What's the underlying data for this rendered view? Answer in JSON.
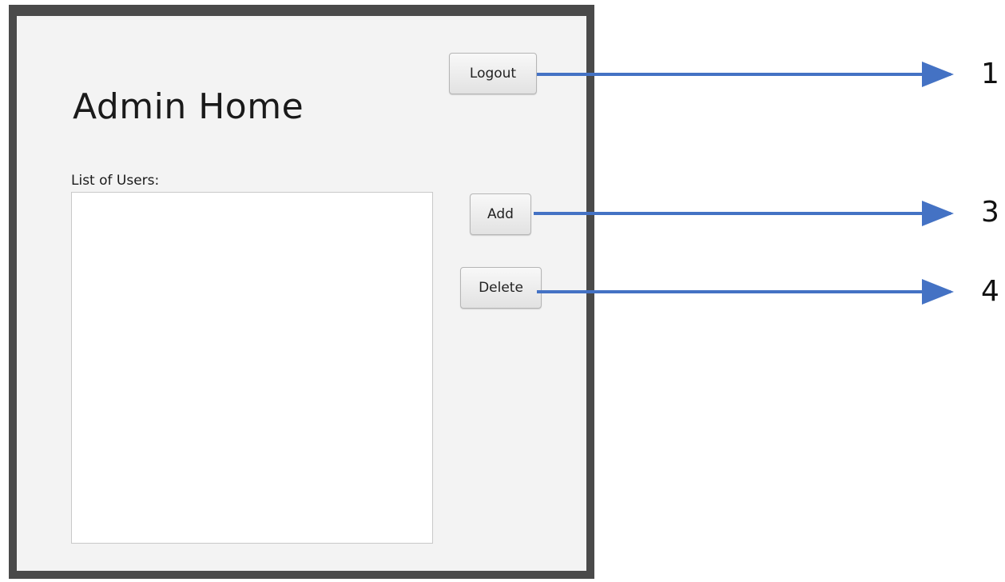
{
  "window": {
    "title": "Admin Home",
    "list_label": "List of Users:",
    "users": []
  },
  "buttons": {
    "logout_label": "Logout",
    "add_label": "Add",
    "delete_label": "Delete"
  },
  "annotations": {
    "callouts": [
      "1",
      "3",
      "4"
    ],
    "arrow_color": "#4472c4"
  },
  "colors": {
    "frame": "#4a4a4a",
    "background": "#f3f3f3",
    "arrow": "#4472c4"
  }
}
